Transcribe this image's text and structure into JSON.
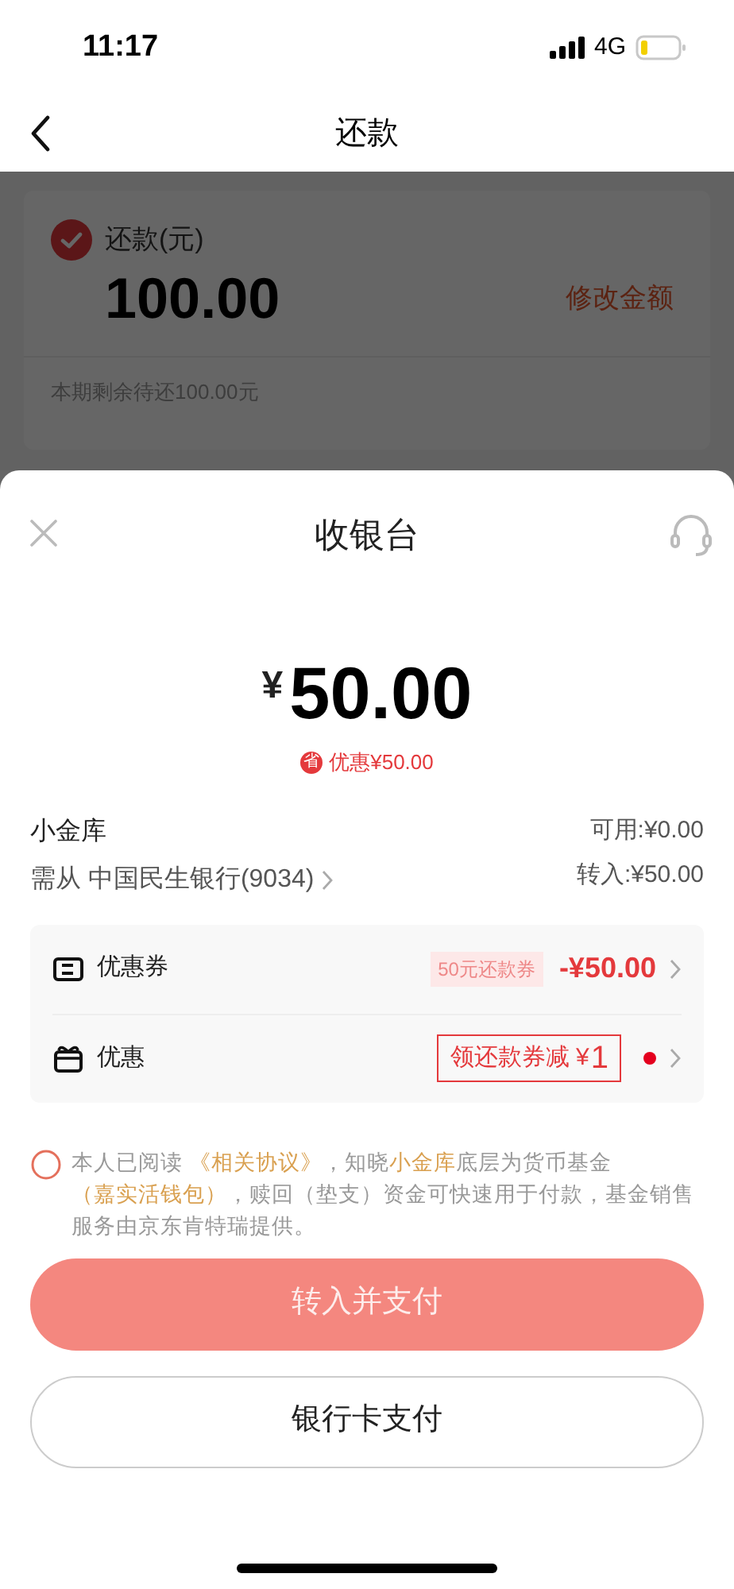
{
  "status_bar": {
    "time": "11:17",
    "network": "4G"
  },
  "nav": {
    "title": "还款"
  },
  "repay_card": {
    "checked": true,
    "label": "还款(元)",
    "amount": "100.00",
    "edit_link": "修改金额",
    "remaining": "本期剩余待还100.00元"
  },
  "cashier": {
    "title": "收银台",
    "currency": "¥",
    "amount": "50.00",
    "discount_badge": "省",
    "discount": "优惠¥50.00",
    "fund": {
      "name": "小金库",
      "source_prefix": "需从",
      "source": "中国民生银行(9034)",
      "available": "可用:¥0.00",
      "transfer": "转入:¥50.00"
    },
    "offers": [
      {
        "kind": "coupon",
        "label": "优惠券",
        "tag": "50元还款券",
        "value": "-¥50.00"
      },
      {
        "kind": "promo",
        "label": "优惠",
        "tag": "领还款券减",
        "tag_currency": "¥",
        "tag_value": "1",
        "dot": true
      }
    ],
    "agreement": {
      "checked": false,
      "segments": [
        {
          "kind": "plain",
          "text": "本人已阅读 "
        },
        {
          "kind": "link",
          "text": "《相关协议》"
        },
        {
          "kind": "plain",
          "text": "，知晓"
        },
        {
          "kind": "link",
          "text": "小金库"
        },
        {
          "kind": "plain",
          "text": "底层为货币基金"
        },
        {
          "kind": "link",
          "text": "（嘉实活钱包）"
        },
        {
          "kind": "plain",
          "text": "，赎回（垫支）资金可快速用于付款，基金销售服务由京东肯特瑞提供。"
        }
      ]
    },
    "buttons": [
      {
        "kind": "primary",
        "label": "转入并支付",
        "disabled": true
      },
      {
        "kind": "outline",
        "label": "银行卡支付"
      }
    ]
  }
}
